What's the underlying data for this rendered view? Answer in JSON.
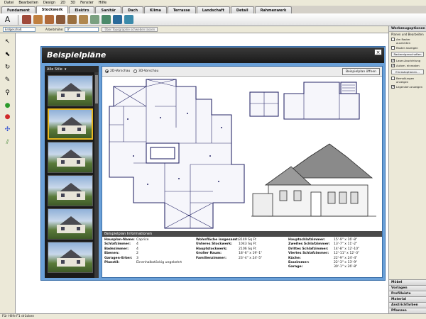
{
  "menu": [
    "Datei",
    "Bearbeiten",
    "Design",
    "2D",
    "3D",
    "Fenster",
    "Hilfe"
  ],
  "tabs": [
    {
      "label": "Fundament",
      "active": false
    },
    {
      "label": "Stockwerk",
      "active": true
    },
    {
      "label": "Elektro",
      "active": false
    },
    {
      "label": "Sanitär",
      "active": false
    },
    {
      "label": "Dach",
      "active": false
    },
    {
      "label": "Klima",
      "active": false
    },
    {
      "label": "Terrasse",
      "active": false
    },
    {
      "label": "Landschaft",
      "active": false
    },
    {
      "label": "Detail",
      "active": false
    },
    {
      "label": "Rahmenwerk",
      "active": false
    }
  ],
  "propbar": {
    "floor_select": "Erdgeschoß",
    "workheight_label": "Arbeitshöhe:",
    "workheight_value": "0\"",
    "topography_button": "Über Topographie schweben lassen"
  },
  "right_panel": {
    "title": "Werkzeugoptionen",
    "subtitle": "Planen und Bearbeiten",
    "checks": [
      {
        "label": "Am Raster ausrichten",
        "checked": false
      },
      {
        "label": "Raster anzeigen",
        "checked": false
      }
    ],
    "grid_button": "Rastereigenschaften",
    "checks2": [
      {
        "label": "Laser-Ausrichtung",
        "checked": true
      },
      {
        "label": "Autom. einrasten",
        "checked": true
      }
    ],
    "snap_button": "Einrastoptionen...",
    "checks3": [
      {
        "label": "Bemaßungen anzeigen",
        "checked": false
      },
      {
        "label": "Legenden anzeigen",
        "checked": true
      }
    ],
    "accordion": [
      "Möbel",
      "Vorlagen",
      "Profilleiste",
      "Material",
      "Anstrichfarben",
      "Pflanzen"
    ]
  },
  "statusbar": "Für Hilfe F1 drücken",
  "dialog": {
    "title": "Beispielpläne",
    "close_icon": "close-icon",
    "filter": "Alle Stile",
    "view_2d": "2D-Vorschau",
    "view_3d": "3D-Vorschau",
    "view_selected": "2D",
    "open_button": "Beispielplan öffnen",
    "info_title": "Beispielplan Informationen",
    "info_col1": [
      {
        "k": "Hausplan-Name:",
        "v": "Caprice"
      },
      {
        "k": "Schlafzimmer:",
        "v": "4"
      },
      {
        "k": "Badezimmer:",
        "v": "4"
      },
      {
        "k": "Ebenen:",
        "v": "2"
      },
      {
        "k": "Garagen-Erker:",
        "v": "3"
      },
      {
        "k": "Planstil:",
        "v": "Einenhalbstöckig ungekehrt"
      }
    ],
    "info_col2": [
      {
        "k": "Wohnfläche insgesamt:",
        "v": "3149 Sq Ft"
      },
      {
        "k": "Unteres Stockwerk:",
        "v": "1043 Sq Ft"
      },
      {
        "k": "Hauptstockwerk:",
        "v": "2106 Sq Ft"
      },
      {
        "k": "Großer Raum:",
        "v": "18'-6\" x 19'-1\""
      },
      {
        "k": "Familienzimmer:",
        "v": "23'-4\" x 24'-5\""
      }
    ],
    "info_col3": [
      {
        "k": "Hauptschlafzimmer:",
        "v": "15'-9\" x 16'-8\""
      },
      {
        "k": "Zweites Schlafzimmer:",
        "v": "13'-7\" x 11'-2\""
      },
      {
        "k": "Drittes Schlafzimmer:",
        "v": "14'-8\" x 12'-10\""
      },
      {
        "k": "Viertes Schlafzimmer:",
        "v": "12'-11\" x 12'-3\""
      },
      {
        "k": "Küche:",
        "v": "22'-9\" x 24'-4\""
      },
      {
        "k": "Esszimmer:",
        "v": "22'-3\" x 13'-9\""
      },
      {
        "k": "Garage:",
        "v": "30'-1\" x 26'-8\""
      }
    ]
  },
  "colors": {
    "dialog_frame": "#6aa0d8",
    "dialog_title_bg": "#1a1a1a",
    "selected_thumb_border": "#e8b820",
    "plan_line": "#2a2a6a"
  }
}
